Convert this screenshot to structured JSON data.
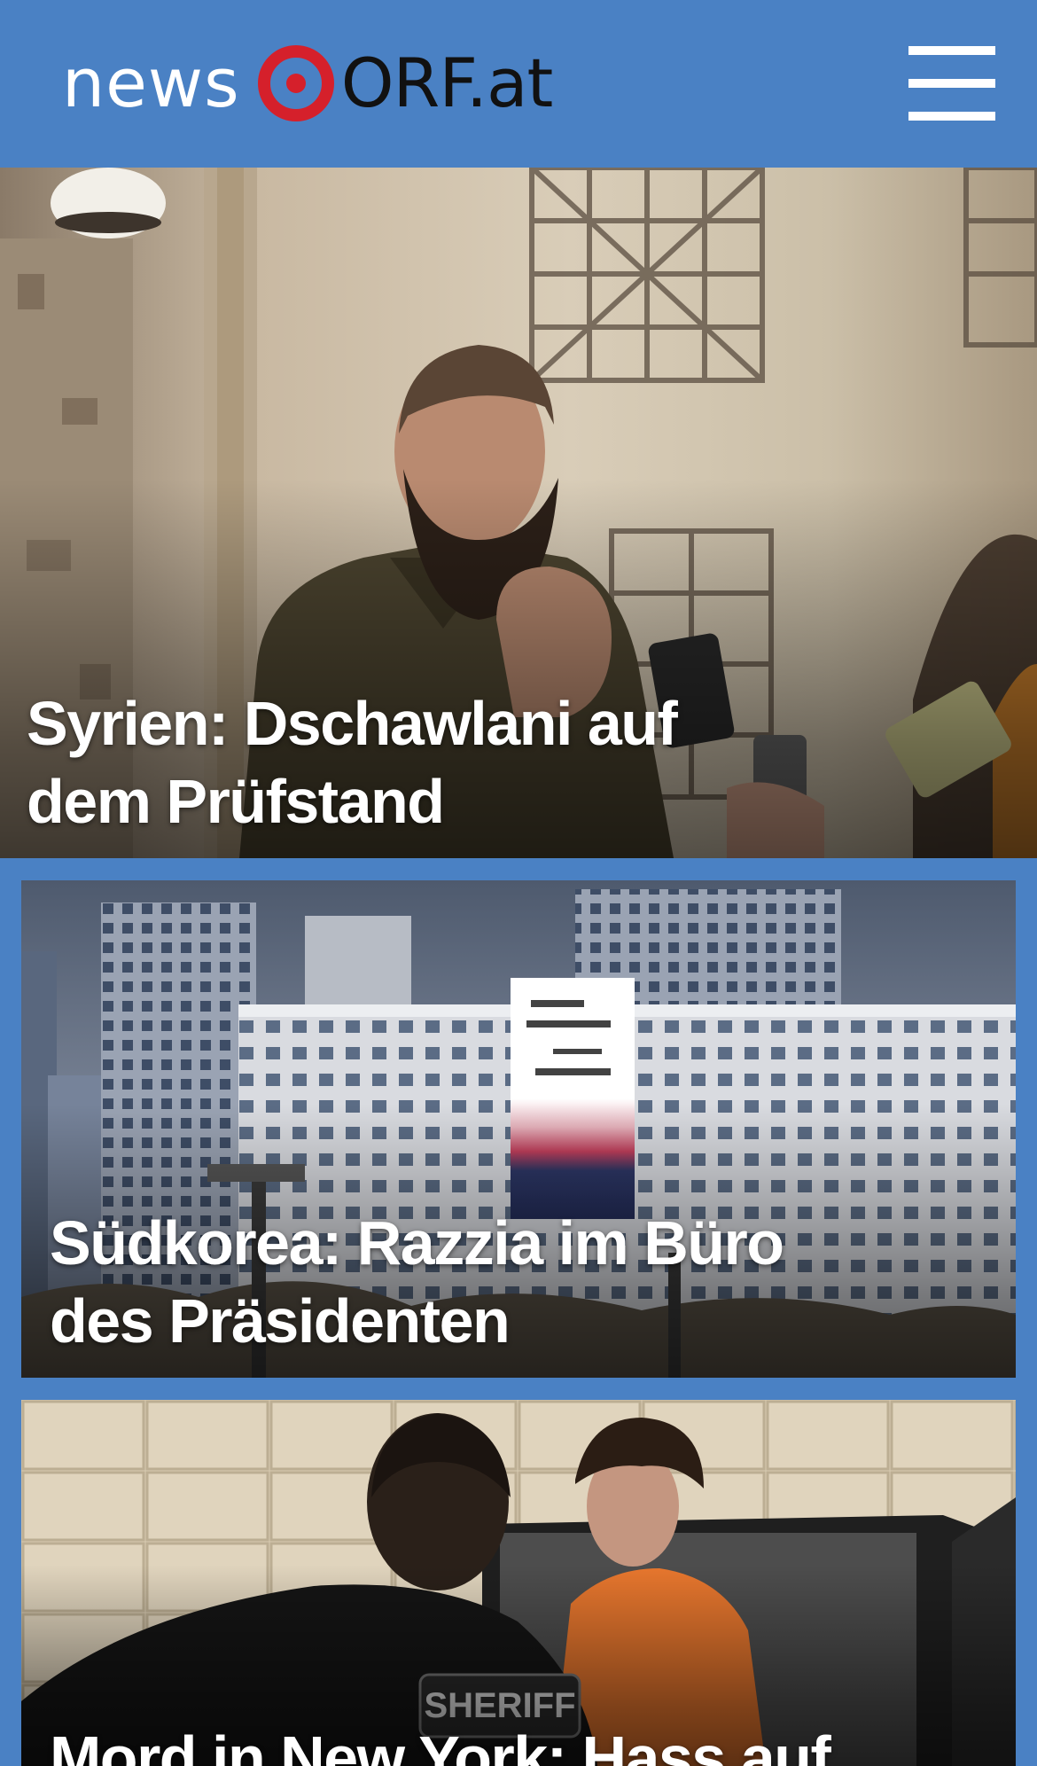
{
  "header": {
    "logo_prefix": "news",
    "logo_suffix": "ORF.at",
    "menu_icon": "hamburger-menu-icon",
    "background_color": "#4a81c4",
    "logo_ring_color": "#d5202b"
  },
  "stories": [
    {
      "title": "Syrien: Dschawlani auf dem Prüfstand"
    },
    {
      "title": "Südkorea: Razzia im Büro des Präsidenten"
    },
    {
      "title": "Mord in New York: Hass auf"
    }
  ]
}
